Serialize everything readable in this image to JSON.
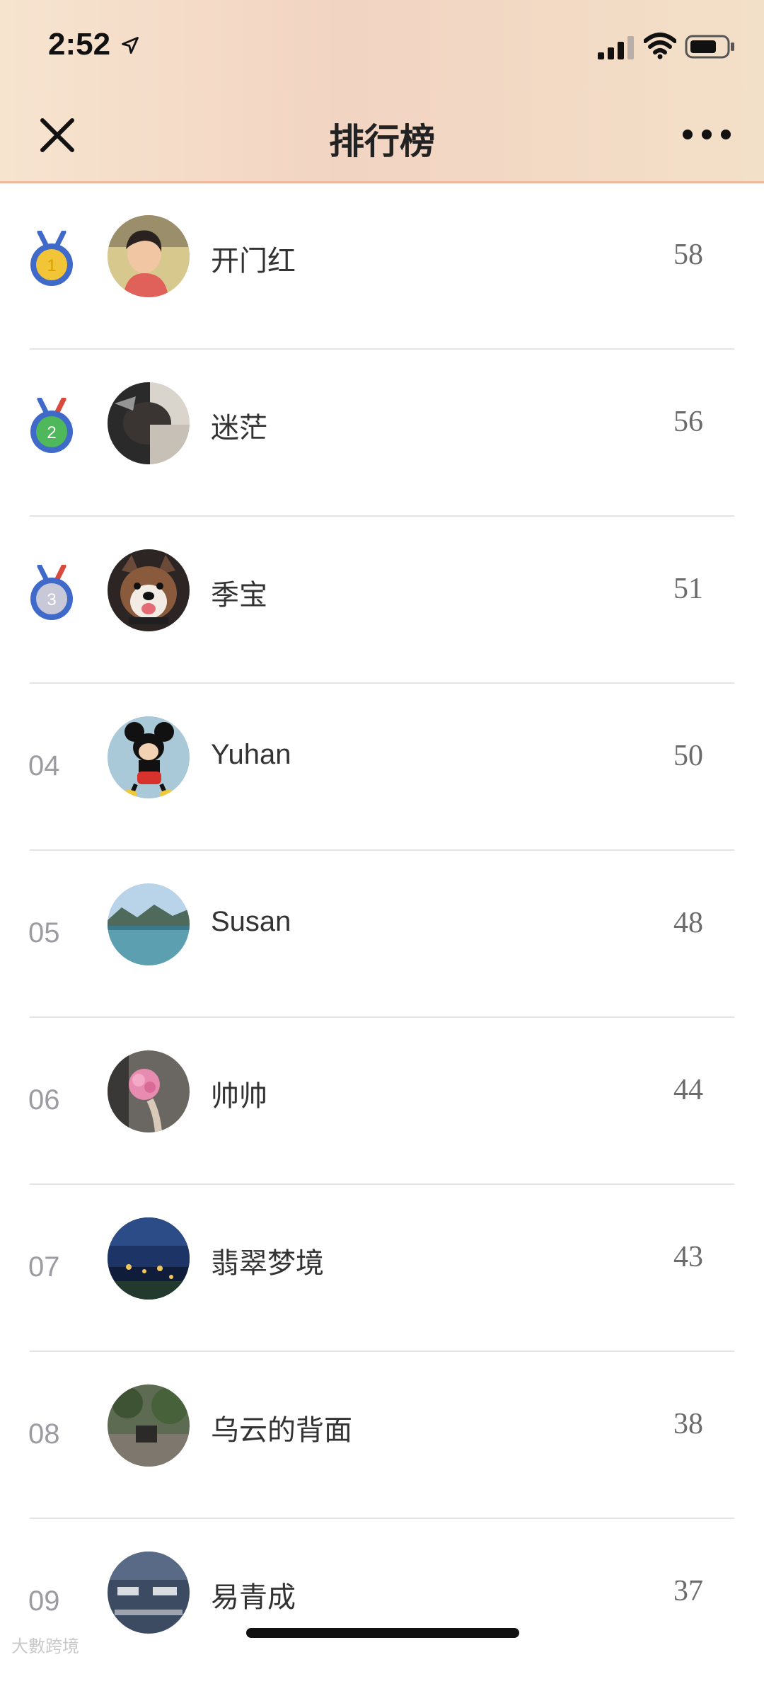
{
  "status": {
    "time": "2:52"
  },
  "header": {
    "title": "排行榜"
  },
  "colors": {
    "header_start": "#f6e4cf",
    "header_end": "#f3e0c8",
    "gold": "#f2c437",
    "green": "#4fb85a",
    "silver": "#c7c9d8",
    "ribbon": "#3f6ac9"
  },
  "rows": [
    {
      "rank": "1",
      "medal": "gold",
      "name": "开门红",
      "score": "58",
      "avatar": "child-photo"
    },
    {
      "rank": "2",
      "medal": "green",
      "name": "迷茫",
      "score": "56",
      "avatar": "blurry-photo"
    },
    {
      "rank": "3",
      "medal": "silver",
      "name": "季宝",
      "score": "51",
      "avatar": "shiba-dog-photo"
    },
    {
      "rank": "04",
      "medal": null,
      "name": "Yuhan",
      "score": "50",
      "avatar": "mickey-mouse"
    },
    {
      "rank": "05",
      "medal": null,
      "name": "Susan",
      "score": "48",
      "avatar": "lake-landscape"
    },
    {
      "rank": "06",
      "medal": null,
      "name": "帅帅",
      "score": "44",
      "avatar": "flower-photo"
    },
    {
      "rank": "07",
      "medal": null,
      "name": "翡翠梦境",
      "score": "43",
      "avatar": "night-town"
    },
    {
      "rank": "08",
      "medal": null,
      "name": "乌云的背面",
      "score": "38",
      "avatar": "garden-photo"
    },
    {
      "rank": "09",
      "medal": null,
      "name": "易青成",
      "score": "37",
      "avatar": "fitness-screen"
    }
  ],
  "watermark": "大數跨境"
}
